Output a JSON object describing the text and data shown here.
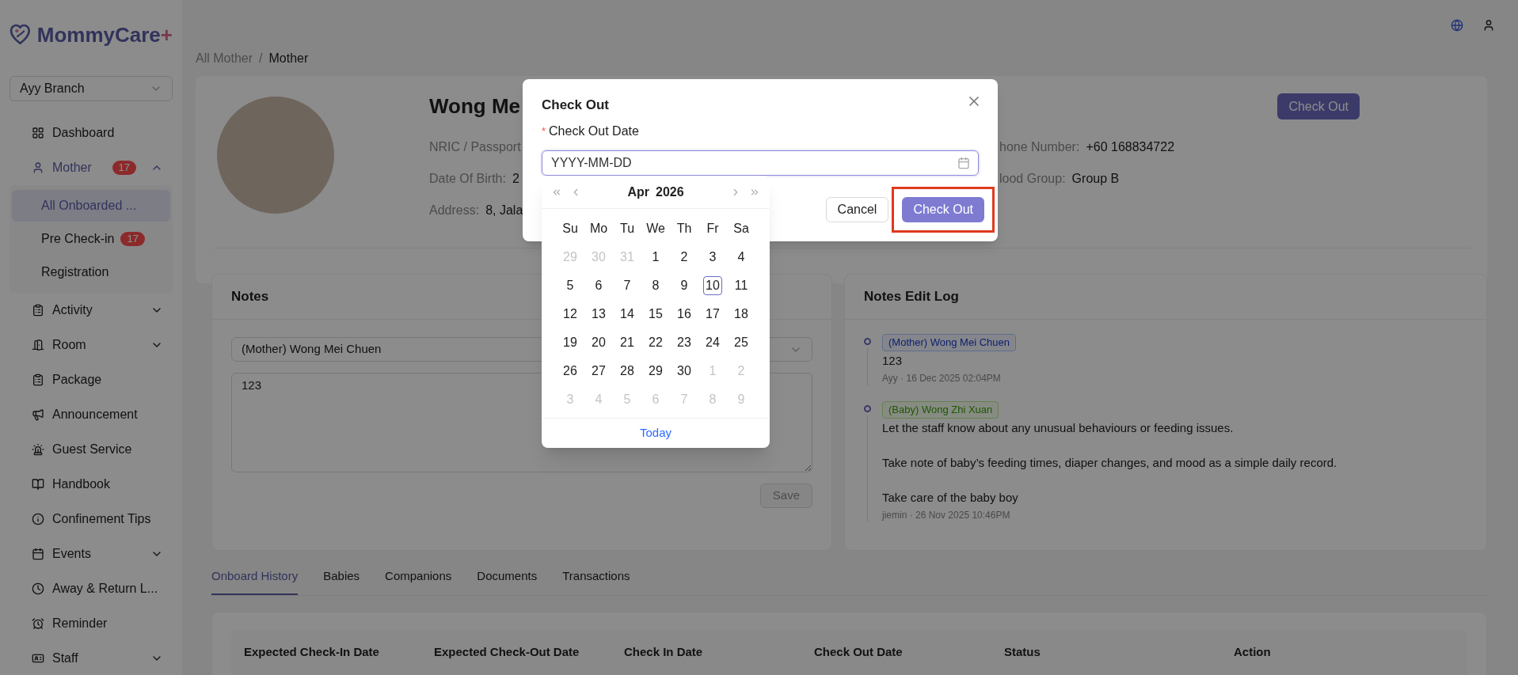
{
  "brand": {
    "name": "MommyCare",
    "mark": "+"
  },
  "branch_select": {
    "value": "Ayy Branch"
  },
  "sidebar": {
    "items": [
      {
        "kind": "item",
        "label": "Dashboard",
        "active": false
      },
      {
        "kind": "group",
        "label": "Mother",
        "badge": "17",
        "active": true,
        "expanded": true,
        "children": [
          {
            "label": "All Onboarded ...",
            "selected": true
          },
          {
            "label": "Pre Check-in",
            "badge": "17",
            "selected": false
          },
          {
            "label": "Registration",
            "selected": false
          }
        ]
      },
      {
        "kind": "group",
        "label": "Activity",
        "active": false,
        "expanded": false
      },
      {
        "kind": "group",
        "label": "Room",
        "active": false,
        "expanded": false
      },
      {
        "kind": "item",
        "label": "Package",
        "active": false
      },
      {
        "kind": "item",
        "label": "Announcement",
        "active": false
      },
      {
        "kind": "item",
        "label": "Guest Service",
        "active": false
      },
      {
        "kind": "item",
        "label": "Handbook",
        "active": false
      },
      {
        "kind": "item",
        "label": "Confinement Tips",
        "active": false
      },
      {
        "kind": "group",
        "label": "Events",
        "active": false,
        "expanded": false
      },
      {
        "kind": "item",
        "label": "Away & Return L...",
        "active": false
      },
      {
        "kind": "item",
        "label": "Reminder",
        "active": false
      },
      {
        "kind": "group",
        "label": "Staff",
        "active": false,
        "expanded": false
      }
    ]
  },
  "breadcrumb": {
    "items": [
      "All Mother",
      "Mother"
    ],
    "separator": "/"
  },
  "profile": {
    "name": "Wong Me",
    "action": "Check Out",
    "left_fields": [
      {
        "label": "NRIC / Passport"
      },
      {
        "label": "Date Of Birth:",
        "value": "2"
      },
      {
        "label": "Address:",
        "value": "8, Jala"
      }
    ],
    "right_fields": [
      {
        "label": "hone Number:",
        "value": "+60 168834722"
      },
      {
        "label": "lood Group:",
        "value": "Group B"
      }
    ]
  },
  "notes": {
    "title": "Notes",
    "subject": "(Mother) Wong Mei Chuen",
    "text": "123",
    "save": "Save"
  },
  "notes_log": {
    "title": "Notes Edit Log",
    "entries": [
      {
        "kind": "mother",
        "tag": "(Mother) Wong Mei Chuen",
        "paragraphs": [
          "123"
        ],
        "meta": "Ayy · 16 Dec 2025 02:04PM"
      },
      {
        "kind": "baby",
        "tag": "(Baby) Wong Zhi Xuan",
        "paragraphs": [
          "Let the staff know about any unusual behaviours or feeding issues.",
          "Take note of baby’s feeding times, diaper changes, and mood as a simple daily record.",
          "Take care of the baby boy"
        ],
        "meta": "jiemin · 26 Nov 2025 10:46PM"
      }
    ]
  },
  "tabs": [
    {
      "label": "Onboard History",
      "selected": true
    },
    {
      "label": "Babies",
      "selected": false
    },
    {
      "label": "Companions",
      "selected": false
    },
    {
      "label": "Documents",
      "selected": false
    },
    {
      "label": "Transactions",
      "selected": false
    }
  ],
  "table": {
    "columns": [
      "Expected Check-In Date",
      "Expected Check-Out Date",
      "Check In Date",
      "Check Out Date",
      "Status",
      "Action"
    ]
  },
  "modal": {
    "title": "Check Out",
    "required_mark": "*",
    "field_label": "Check Out Date",
    "placeholder": "YYYY-MM-DD",
    "cancel": "Cancel",
    "confirm": {
      "label": "Check Out",
      "highlighted": true
    }
  },
  "calendar": {
    "month": "Apr",
    "year": "2026",
    "weekdays": [
      "Su",
      "Mo",
      "Tu",
      "We",
      "Th",
      "Fr",
      "Sa"
    ],
    "days": [
      {
        "day": "29",
        "outside": true,
        "today": false
      },
      {
        "day": "30",
        "outside": true,
        "today": false
      },
      {
        "day": "31",
        "outside": true,
        "today": false
      },
      {
        "day": "1",
        "outside": false,
        "today": false
      },
      {
        "day": "2",
        "outside": false,
        "today": false
      },
      {
        "day": "3",
        "outside": false,
        "today": false
      },
      {
        "day": "4",
        "outside": false,
        "today": false
      },
      {
        "day": "5",
        "outside": false,
        "today": false
      },
      {
        "day": "6",
        "outside": false,
        "today": false
      },
      {
        "day": "7",
        "outside": false,
        "today": false
      },
      {
        "day": "8",
        "outside": false,
        "today": false
      },
      {
        "day": "9",
        "outside": false,
        "today": false
      },
      {
        "day": "10",
        "outside": false,
        "today": true
      },
      {
        "day": "11",
        "outside": false,
        "today": false
      },
      {
        "day": "12",
        "outside": false,
        "today": false
      },
      {
        "day": "13",
        "outside": false,
        "today": false
      },
      {
        "day": "14",
        "outside": false,
        "today": false
      },
      {
        "day": "15",
        "outside": false,
        "today": false
      },
      {
        "day": "16",
        "outside": false,
        "today": false
      },
      {
        "day": "17",
        "outside": false,
        "today": false
      },
      {
        "day": "18",
        "outside": false,
        "today": false
      },
      {
        "day": "19",
        "outside": false,
        "today": false
      },
      {
        "day": "20",
        "outside": false,
        "today": false
      },
      {
        "day": "21",
        "outside": false,
        "today": false
      },
      {
        "day": "22",
        "outside": false,
        "today": false
      },
      {
        "day": "23",
        "outside": false,
        "today": false
      },
      {
        "day": "24",
        "outside": false,
        "today": false
      },
      {
        "day": "25",
        "outside": false,
        "today": false
      },
      {
        "day": "26",
        "outside": false,
        "today": false
      },
      {
        "day": "27",
        "outside": false,
        "today": false
      },
      {
        "day": "28",
        "outside": false,
        "today": false
      },
      {
        "day": "29",
        "outside": false,
        "today": false
      },
      {
        "day": "30",
        "outside": false,
        "today": false
      },
      {
        "day": "1",
        "outside": true,
        "today": false
      },
      {
        "day": "2",
        "outside": true,
        "today": false
      },
      {
        "day": "3",
        "outside": true,
        "today": false
      },
      {
        "day": "4",
        "outside": true,
        "today": false
      },
      {
        "day": "5",
        "outside": true,
        "today": false
      },
      {
        "day": "6",
        "outside": true,
        "today": false
      },
      {
        "day": "7",
        "outside": true,
        "today": false
      },
      {
        "day": "8",
        "outside": true,
        "today": false
      },
      {
        "day": "9",
        "outside": true,
        "today": false
      }
    ],
    "today_link": "Today"
  }
}
